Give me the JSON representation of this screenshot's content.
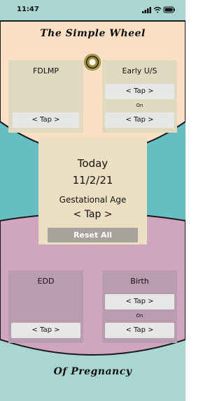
{
  "status_bar": {
    "time": "11:47",
    "icons": [
      "signal-icon",
      "wifi-icon",
      "battery-icon"
    ]
  },
  "app": {
    "title": "The Simple Wheel",
    "subtitle": "Of Pregnancy"
  },
  "colors": {
    "wheel_top": "#fce0c6",
    "teal_ring": "#67bec2",
    "wheel_bottom": "#cfa5bf",
    "base_band": "#a9d6d3"
  },
  "top_cards": {
    "fdlmp": {
      "label": "FDLMP",
      "tap": "< Tap >"
    },
    "early_us": {
      "label": "Early U/S",
      "tap_top": "< Tap >",
      "on": "On",
      "tap_bottom": "< Tap >"
    }
  },
  "center": {
    "today_label": "Today",
    "date": "11/2/21",
    "ga_label": "Gestational Age",
    "ga_tap": "< Tap >",
    "reset": "Reset All"
  },
  "bottom_cards": {
    "edd": {
      "label": "EDD",
      "tap": "< Tap >"
    },
    "birth": {
      "label": "Birth",
      "tap_top": "< Tap >",
      "on": "On",
      "tap_bottom": "< Tap >"
    }
  }
}
